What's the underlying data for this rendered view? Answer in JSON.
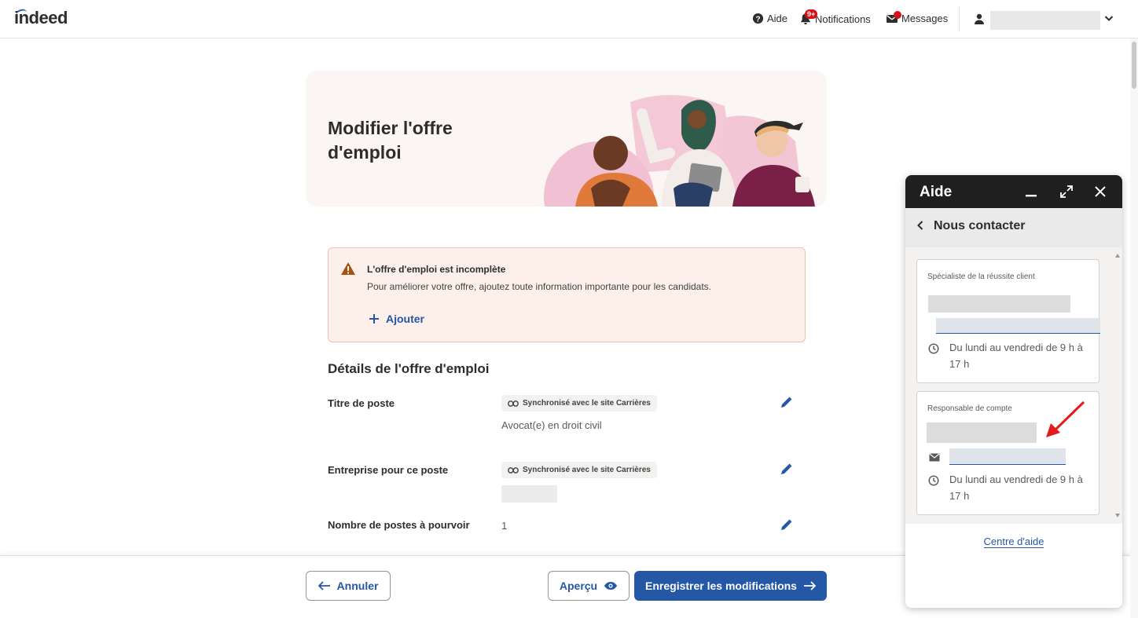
{
  "header": {
    "logo": "indeed",
    "help_label": "Aide",
    "notifications_label": "Notifications",
    "notifications_badge": "9+",
    "messages_label": "Messages"
  },
  "hero": {
    "title_line1": "Modifier l'offre",
    "title_line2": "d'emploi"
  },
  "warning": {
    "title": "L'offre d'emploi est incomplète",
    "text": "Pour améliorer votre offre, ajoutez toute information importante pour les candidats.",
    "add_label": "Ajouter"
  },
  "details": {
    "section_title": "Détails de l'offre d'emploi",
    "rows": [
      {
        "label": "Titre de poste",
        "sync": "Synchronisé avec le site Carrières",
        "value": "Avocat(e) en droit civil"
      },
      {
        "label": "Entreprise pour ce poste",
        "sync": "Synchronisé avec le site Carrières",
        "value": ""
      },
      {
        "label": "Nombre de postes à pourvoir",
        "sync": "",
        "value": "1"
      }
    ]
  },
  "footer": {
    "cancel_label": "Annuler",
    "preview_label": "Aperçu",
    "save_label": "Enregistrer les modifications"
  },
  "help_panel": {
    "title": "Aide",
    "subtitle": "Nous contacter",
    "card1_label": "Spécialiste de la réussite client",
    "card1_hours": "Du lundi au vendredi de 9 h à 17 h",
    "card2_label": "Responsable de compte",
    "card2_hours": "Du lundi au vendredi de 9 h à 17 h",
    "help_center_link": "Centre d'aide"
  },
  "colors": {
    "brand_blue": "#2557a7",
    "warning_bg": "#fdf0ea",
    "warning_icon": "#a9520f",
    "badge_red": "#d4111a",
    "arrow_red": "#e31b1b"
  }
}
